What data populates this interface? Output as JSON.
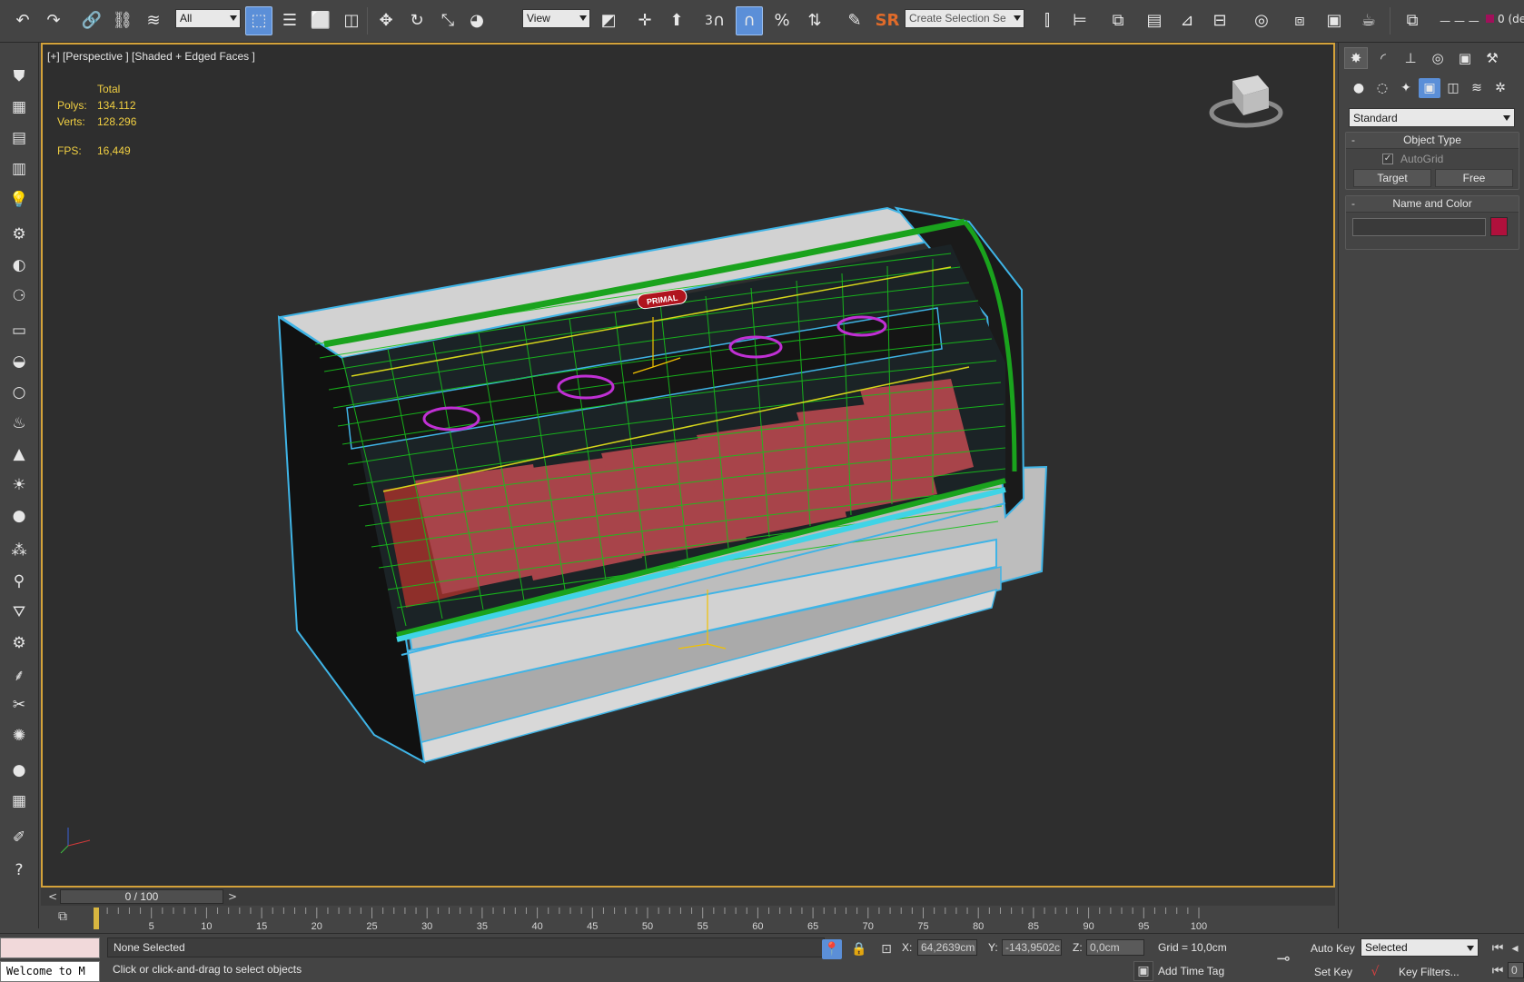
{
  "toolbar": {
    "selection_filter": "All",
    "reference_coord": "View",
    "snap_number": "3",
    "sr_label": "SR",
    "named_selection_placeholder": "Create Selection Se",
    "layer_label": "0 (de"
  },
  "viewport": {
    "label": "[+] [Perspective ] [Shaded + Edged Faces ]",
    "stats_header": "Total",
    "polys_label": "Polys:",
    "polys_value": "134.112",
    "verts_label": "Verts:",
    "verts_value": "128.296",
    "fps_label": "FPS:",
    "fps_value": "16,449",
    "signage_text": "PRIMAL"
  },
  "command_panel": {
    "category_dropdown": "Standard",
    "object_type_title": "Object Type",
    "autogrid_label": "AutoGrid",
    "autogrid_checked": true,
    "target_button": "Target",
    "free_button": "Free",
    "name_color_title": "Name and Color",
    "object_color": "#b0103c"
  },
  "timeline": {
    "frame_counter": "0 / 100",
    "prev_label": "<",
    "next_label": ">",
    "ticks": [
      "5",
      "10",
      "15",
      "20",
      "25",
      "30",
      "35",
      "40",
      "45",
      "50",
      "55",
      "60",
      "65",
      "70",
      "75",
      "80",
      "85",
      "90",
      "95",
      "100"
    ]
  },
  "status": {
    "listener_text": "Welcome to M",
    "selection_text": "None Selected",
    "prompt_text": "Click or click-and-drag to select objects",
    "x_label": "X:",
    "x_value": "64,2639cm",
    "y_label": "Y:",
    "y_value": "-143,9502c",
    "z_label": "Z:",
    "z_value": "0,0cm",
    "grid_text": "Grid = 10,0cm",
    "add_time_tag": "Add Time Tag",
    "auto_key": "Auto Key",
    "set_key": "Set Key",
    "selected_dropdown": "Selected",
    "key_filters": "Key Filters...",
    "frame_field": "0"
  }
}
